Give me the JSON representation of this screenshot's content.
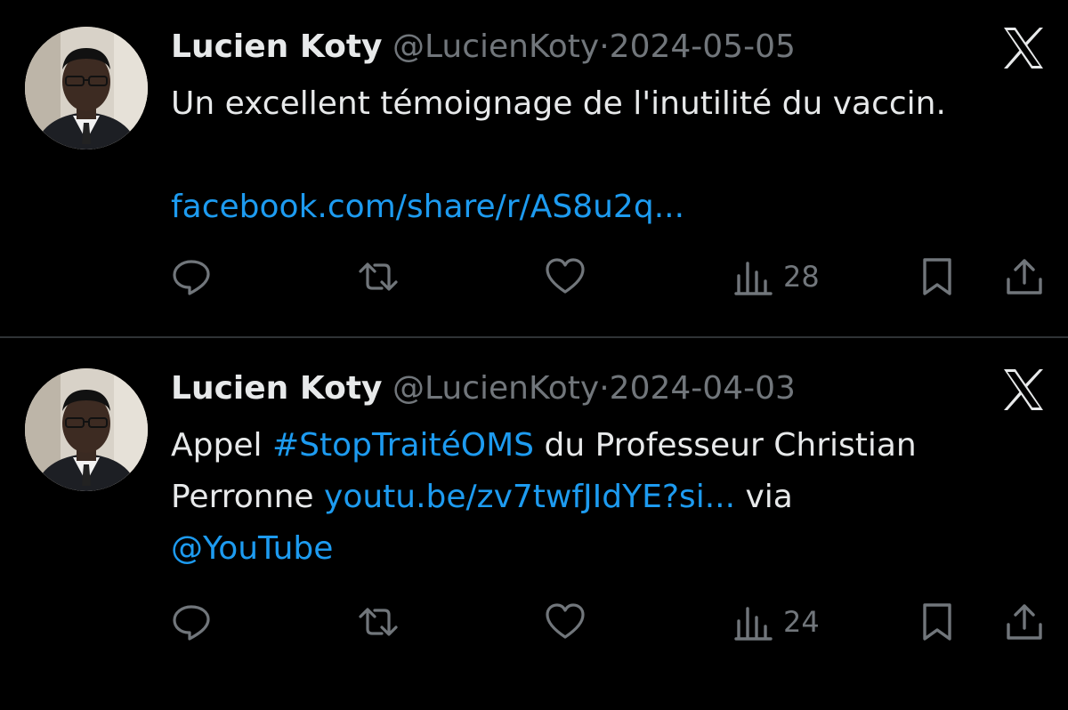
{
  "tweets": [
    {
      "name": "Lucien Koty",
      "handle": "@LucienKoty",
      "separator": "·",
      "date": "2024-05-05",
      "text_1": "Un excellent témoignage de l'inutilité du vaccin.",
      "link": "facebook.com/share/r/AS8u2q...",
      "views": "28"
    },
    {
      "name": "Lucien Koty",
      "handle": "@LucienKoty",
      "separator": "·",
      "date": "2024-04-03",
      "text_1": "Appel ",
      "hashtag": "#StopTraitéOMS",
      "text_2": " du Professeur Christian",
      "text_3": "Perronne ",
      "link": "youtu.be/zv7twfJIdYE?si...",
      "text_4": " via",
      "mention": "@YouTube",
      "views": "24"
    }
  ],
  "icons": {
    "reply": "reply-icon",
    "retweet": "retweet-icon",
    "like": "heart-icon",
    "views": "views-icon",
    "bookmark": "bookmark-icon",
    "share": "share-icon",
    "brand": "x-logo-icon"
  },
  "colors": {
    "background": "#000000",
    "text": "#e7e9ea",
    "muted": "#71767b",
    "link": "#1d9bf0"
  }
}
